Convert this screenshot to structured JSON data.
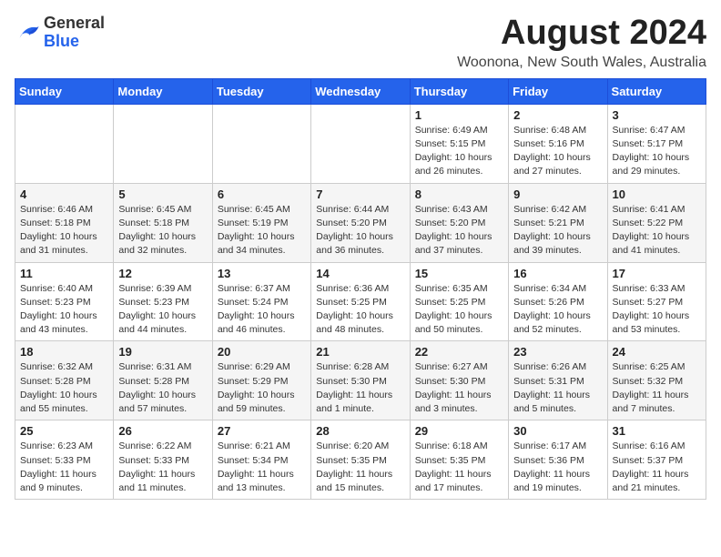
{
  "logo": {
    "general": "General",
    "blue": "Blue"
  },
  "calendar": {
    "title": "August 2024",
    "subtitle": "Woonona, New South Wales, Australia"
  },
  "headers": [
    "Sunday",
    "Monday",
    "Tuesday",
    "Wednesday",
    "Thursday",
    "Friday",
    "Saturday"
  ],
  "weeks": [
    [
      {
        "day": "",
        "info": ""
      },
      {
        "day": "",
        "info": ""
      },
      {
        "day": "",
        "info": ""
      },
      {
        "day": "",
        "info": ""
      },
      {
        "day": "1",
        "info": "Sunrise: 6:49 AM\nSunset: 5:15 PM\nDaylight: 10 hours\nand 26 minutes."
      },
      {
        "day": "2",
        "info": "Sunrise: 6:48 AM\nSunset: 5:16 PM\nDaylight: 10 hours\nand 27 minutes."
      },
      {
        "day": "3",
        "info": "Sunrise: 6:47 AM\nSunset: 5:17 PM\nDaylight: 10 hours\nand 29 minutes."
      }
    ],
    [
      {
        "day": "4",
        "info": "Sunrise: 6:46 AM\nSunset: 5:18 PM\nDaylight: 10 hours\nand 31 minutes."
      },
      {
        "day": "5",
        "info": "Sunrise: 6:45 AM\nSunset: 5:18 PM\nDaylight: 10 hours\nand 32 minutes."
      },
      {
        "day": "6",
        "info": "Sunrise: 6:45 AM\nSunset: 5:19 PM\nDaylight: 10 hours\nand 34 minutes."
      },
      {
        "day": "7",
        "info": "Sunrise: 6:44 AM\nSunset: 5:20 PM\nDaylight: 10 hours\nand 36 minutes."
      },
      {
        "day": "8",
        "info": "Sunrise: 6:43 AM\nSunset: 5:20 PM\nDaylight: 10 hours\nand 37 minutes."
      },
      {
        "day": "9",
        "info": "Sunrise: 6:42 AM\nSunset: 5:21 PM\nDaylight: 10 hours\nand 39 minutes."
      },
      {
        "day": "10",
        "info": "Sunrise: 6:41 AM\nSunset: 5:22 PM\nDaylight: 10 hours\nand 41 minutes."
      }
    ],
    [
      {
        "day": "11",
        "info": "Sunrise: 6:40 AM\nSunset: 5:23 PM\nDaylight: 10 hours\nand 43 minutes."
      },
      {
        "day": "12",
        "info": "Sunrise: 6:39 AM\nSunset: 5:23 PM\nDaylight: 10 hours\nand 44 minutes."
      },
      {
        "day": "13",
        "info": "Sunrise: 6:37 AM\nSunset: 5:24 PM\nDaylight: 10 hours\nand 46 minutes."
      },
      {
        "day": "14",
        "info": "Sunrise: 6:36 AM\nSunset: 5:25 PM\nDaylight: 10 hours\nand 48 minutes."
      },
      {
        "day": "15",
        "info": "Sunrise: 6:35 AM\nSunset: 5:25 PM\nDaylight: 10 hours\nand 50 minutes."
      },
      {
        "day": "16",
        "info": "Sunrise: 6:34 AM\nSunset: 5:26 PM\nDaylight: 10 hours\nand 52 minutes."
      },
      {
        "day": "17",
        "info": "Sunrise: 6:33 AM\nSunset: 5:27 PM\nDaylight: 10 hours\nand 53 minutes."
      }
    ],
    [
      {
        "day": "18",
        "info": "Sunrise: 6:32 AM\nSunset: 5:28 PM\nDaylight: 10 hours\nand 55 minutes."
      },
      {
        "day": "19",
        "info": "Sunrise: 6:31 AM\nSunset: 5:28 PM\nDaylight: 10 hours\nand 57 minutes."
      },
      {
        "day": "20",
        "info": "Sunrise: 6:29 AM\nSunset: 5:29 PM\nDaylight: 10 hours\nand 59 minutes."
      },
      {
        "day": "21",
        "info": "Sunrise: 6:28 AM\nSunset: 5:30 PM\nDaylight: 11 hours\nand 1 minute."
      },
      {
        "day": "22",
        "info": "Sunrise: 6:27 AM\nSunset: 5:30 PM\nDaylight: 11 hours\nand 3 minutes."
      },
      {
        "day": "23",
        "info": "Sunrise: 6:26 AM\nSunset: 5:31 PM\nDaylight: 11 hours\nand 5 minutes."
      },
      {
        "day": "24",
        "info": "Sunrise: 6:25 AM\nSunset: 5:32 PM\nDaylight: 11 hours\nand 7 minutes."
      }
    ],
    [
      {
        "day": "25",
        "info": "Sunrise: 6:23 AM\nSunset: 5:33 PM\nDaylight: 11 hours\nand 9 minutes."
      },
      {
        "day": "26",
        "info": "Sunrise: 6:22 AM\nSunset: 5:33 PM\nDaylight: 11 hours\nand 11 minutes."
      },
      {
        "day": "27",
        "info": "Sunrise: 6:21 AM\nSunset: 5:34 PM\nDaylight: 11 hours\nand 13 minutes."
      },
      {
        "day": "28",
        "info": "Sunrise: 6:20 AM\nSunset: 5:35 PM\nDaylight: 11 hours\nand 15 minutes."
      },
      {
        "day": "29",
        "info": "Sunrise: 6:18 AM\nSunset: 5:35 PM\nDaylight: 11 hours\nand 17 minutes."
      },
      {
        "day": "30",
        "info": "Sunrise: 6:17 AM\nSunset: 5:36 PM\nDaylight: 11 hours\nand 19 minutes."
      },
      {
        "day": "31",
        "info": "Sunrise: 6:16 AM\nSunset: 5:37 PM\nDaylight: 11 hours\nand 21 minutes."
      }
    ]
  ]
}
